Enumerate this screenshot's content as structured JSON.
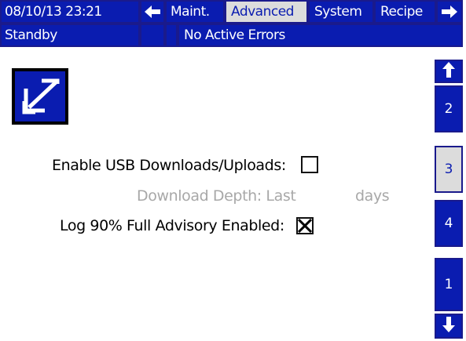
{
  "header": {
    "datetime": "08/10/13 23:21",
    "tabs": [
      {
        "label": "Maint.",
        "active": false
      },
      {
        "label": "Advanced",
        "active": true
      },
      {
        "label": "System",
        "active": false
      },
      {
        "label": "Recipe",
        "active": false
      }
    ],
    "left_arrow_icon": "arrow-left-icon",
    "right_arrow_icon": "arrow-right-icon"
  },
  "status": {
    "mode": "Standby",
    "errors": "No Active Errors"
  },
  "screen_icon": "edit-screen-icon",
  "settings": {
    "usb_label": "Enable USB Downloads/Uploads:",
    "usb_checked": false,
    "depth_label": "Download Depth: Last",
    "depth_value": "",
    "depth_unit": "days",
    "log_label": "Log 90% Full Advisory Enabled:",
    "log_checked": true
  },
  "side_nav": {
    "up_icon": "arrow-up-icon",
    "down_icon": "arrow-down-icon",
    "pages": [
      {
        "label": "2",
        "active": false
      },
      {
        "label": "3",
        "active": true
      },
      {
        "label": "4",
        "active": false
      },
      {
        "label": "1",
        "active": false
      }
    ]
  },
  "colors": {
    "accent": "#0a1cb0",
    "active_tab": "#dcdcdc",
    "dim_text": "#a8a8a8"
  }
}
